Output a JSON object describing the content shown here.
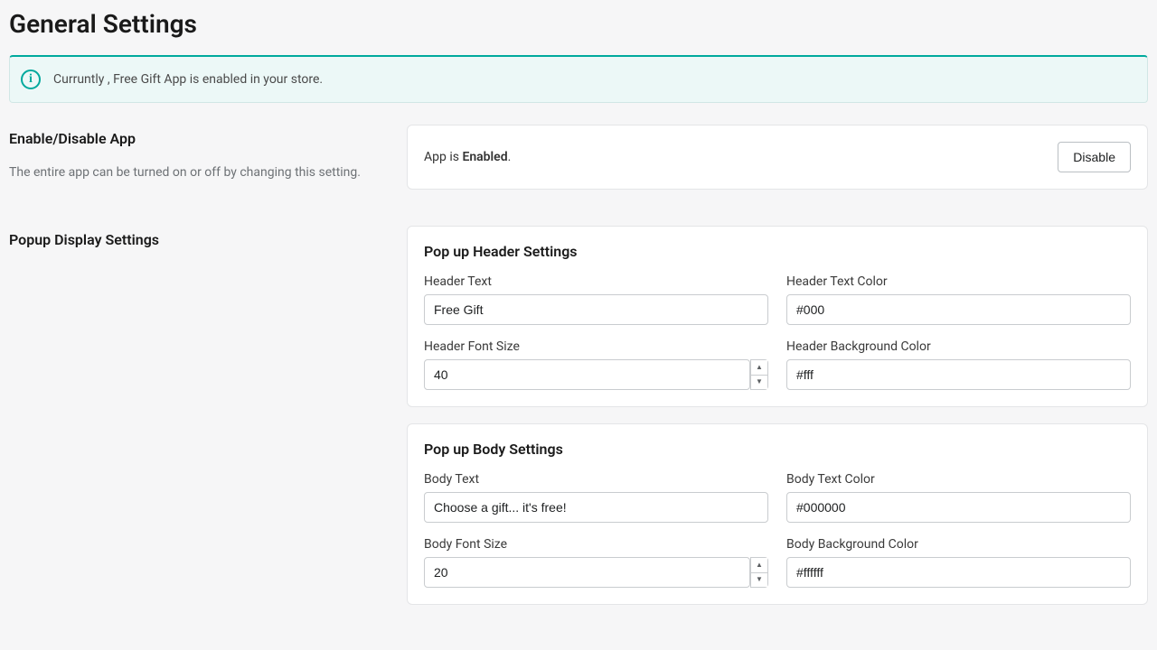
{
  "page_title": "General Settings",
  "banner_text": "Curruntly , Free Gift App is enabled in your store.",
  "sections": {
    "enable": {
      "heading": "Enable/Disable App",
      "description": "The entire app can be turned on or off by changing this setting.",
      "status_prefix": "App is ",
      "status_value": "Enabled",
      "status_suffix": ".",
      "button_label": "Disable"
    },
    "popup": {
      "heading": "Popup Display Settings"
    }
  },
  "header_settings": {
    "card_title": "Pop up Header Settings",
    "text_label": "Header Text",
    "text_value": "Free Gift",
    "color_label": "Header Text Color",
    "color_value": "#000",
    "font_label": "Header Font Size",
    "font_value": "40",
    "bg_label": "Header Background Color",
    "bg_value": "#fff"
  },
  "body_settings": {
    "card_title": "Pop up Body Settings",
    "text_label": "Body Text",
    "text_value": "Choose a gift... it's free!",
    "color_label": "Body Text Color",
    "color_value": "#000000",
    "font_label": "Body Font Size",
    "font_value": "20",
    "bg_label": "Body Background Color",
    "bg_value": "#ffffff"
  }
}
